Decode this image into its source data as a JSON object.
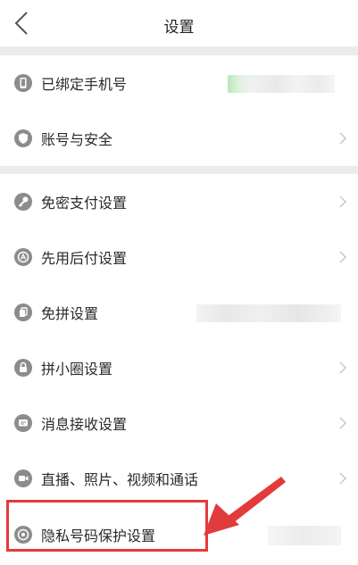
{
  "header": {
    "title": "设置"
  },
  "sections": [
    {
      "items": [
        {
          "label": "已绑定手机号",
          "icon": "phone-icon"
        },
        {
          "label": "账号与安全",
          "icon": "shield-icon"
        }
      ]
    },
    {
      "items": [
        {
          "label": "免密支付设置",
          "icon": "key-icon"
        },
        {
          "label": "先用后付设置",
          "icon": "pay-later-icon"
        },
        {
          "label": "免拼设置",
          "icon": "copy-icon"
        },
        {
          "label": "拼小圈设置",
          "icon": "lock-icon"
        },
        {
          "label": "消息接收设置",
          "icon": "message-icon"
        },
        {
          "label": "直播、照片、视频和通话",
          "icon": "video-icon"
        },
        {
          "label": "隐私号码保护设置",
          "icon": "privacy-icon"
        }
      ]
    }
  ],
  "colors": {
    "icon": "#8c8c8c",
    "divider": "#ececec",
    "highlight": "#e23b3b"
  }
}
